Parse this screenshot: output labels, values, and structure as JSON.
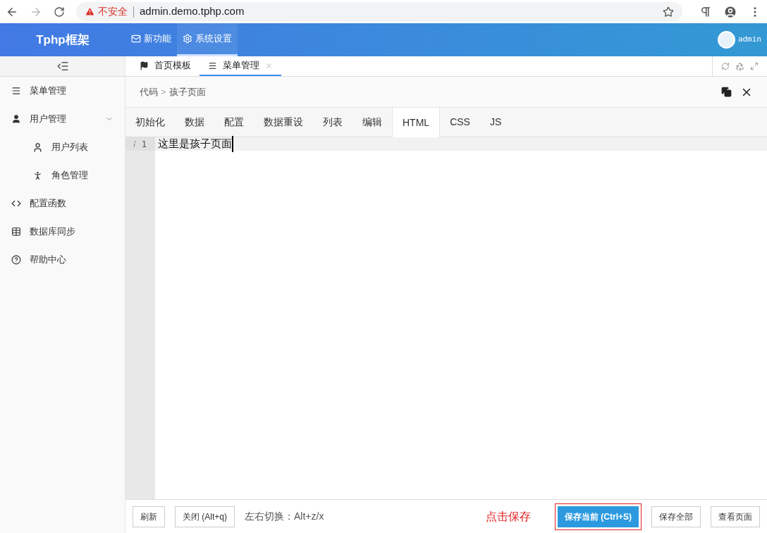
{
  "browser": {
    "security": "不安全",
    "address": "admin.demo.tphp.com"
  },
  "header": {
    "brand": "Tphp框架",
    "nav": [
      {
        "label": "新功能",
        "selected": false
      },
      {
        "label": "系统设置",
        "selected": true
      }
    ],
    "user": "admin"
  },
  "page_tabs": [
    {
      "label": "首页模板",
      "selected": false,
      "closable": false
    },
    {
      "label": "菜单管理",
      "selected": true,
      "closable": true
    }
  ],
  "sidebar": {
    "items": [
      {
        "label": "菜单管理"
      },
      {
        "label": "用户管理",
        "expanded": true,
        "children": [
          {
            "label": "用户列表"
          },
          {
            "label": "角色管理"
          }
        ]
      },
      {
        "label": "配置函数"
      },
      {
        "label": "数据库同步"
      },
      {
        "label": "帮助中心"
      }
    ]
  },
  "breadcrumb": {
    "items": [
      "代码",
      "孩子页面"
    ],
    "separator": ">"
  },
  "editor_tabs": [
    {
      "label": "初始化",
      "selected": false
    },
    {
      "label": "数据",
      "selected": false
    },
    {
      "label": "配置",
      "selected": false
    },
    {
      "label": "数据重设",
      "selected": false
    },
    {
      "label": "列表",
      "selected": false
    },
    {
      "label": "编辑",
      "selected": false
    },
    {
      "label": "HTML",
      "selected": true
    },
    {
      "label": "CSS",
      "selected": false
    },
    {
      "label": "JS",
      "selected": false
    }
  ],
  "editor": {
    "lines": [
      {
        "number": "1",
        "text": "这里是孩子页面"
      }
    ]
  },
  "footer": {
    "left_buttons": [
      {
        "label": "刷新"
      },
      {
        "label": "关闭 (Alt+q)"
      }
    ],
    "hint": "左右切换：Alt+z/x",
    "annotation": "点击保存",
    "right_buttons": [
      {
        "label": "保存当前 (Ctrl+S)",
        "kind": "primary"
      },
      {
        "label": "保存全部",
        "kind": "default"
      },
      {
        "label": "查看页面",
        "kind": "default"
      }
    ]
  }
}
